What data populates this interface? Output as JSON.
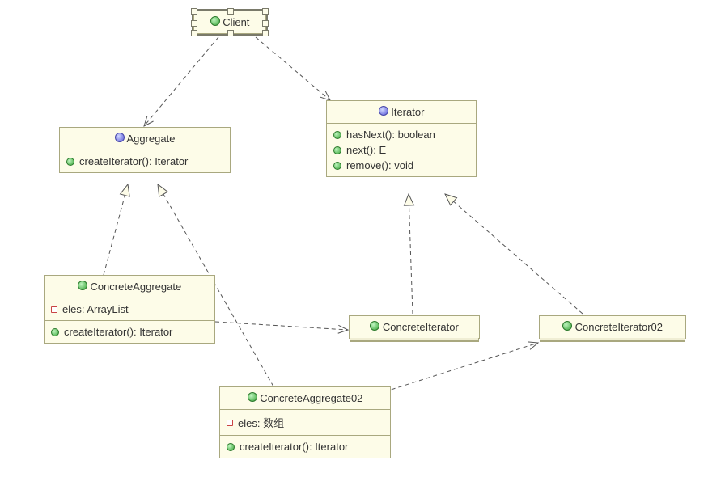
{
  "classes": {
    "client": {
      "name": "Client",
      "type": "class"
    },
    "aggregate": {
      "name": "Aggregate",
      "type": "interface",
      "methods": [
        "createIterator(): Iterator"
      ]
    },
    "iterator": {
      "name": "Iterator",
      "type": "interface",
      "methods": [
        "hasNext(): boolean",
        "next(): E",
        "remove(): void"
      ]
    },
    "concreteAggregate": {
      "name": "ConcreteAggregate",
      "type": "class",
      "fields": [
        "eles: ArrayList"
      ],
      "methods": [
        "createIterator(): Iterator"
      ]
    },
    "concreteIterator": {
      "name": "ConcreteIterator",
      "type": "class"
    },
    "concreteIterator02": {
      "name": "ConcreteIterator02",
      "type": "class"
    },
    "concreteAggregate02": {
      "name": "ConcreteAggregate02",
      "type": "class",
      "fields": [
        "eles: 数组"
      ],
      "methods": [
        "createIterator(): Iterator"
      ]
    }
  },
  "relationships": [
    {
      "from": "Client",
      "to": "Aggregate",
      "type": "dependency"
    },
    {
      "from": "Client",
      "to": "Iterator",
      "type": "dependency"
    },
    {
      "from": "ConcreteAggregate",
      "to": "Aggregate",
      "type": "realization"
    },
    {
      "from": "ConcreteAggregate02",
      "to": "Aggregate",
      "type": "realization"
    },
    {
      "from": "ConcreteIterator",
      "to": "Iterator",
      "type": "realization"
    },
    {
      "from": "ConcreteIterator02",
      "to": "Iterator",
      "type": "realization"
    },
    {
      "from": "ConcreteAggregate",
      "to": "ConcreteIterator",
      "type": "dependency"
    },
    {
      "from": "ConcreteAggregate02",
      "to": "ConcreteIterator02",
      "type": "dependency"
    }
  ]
}
